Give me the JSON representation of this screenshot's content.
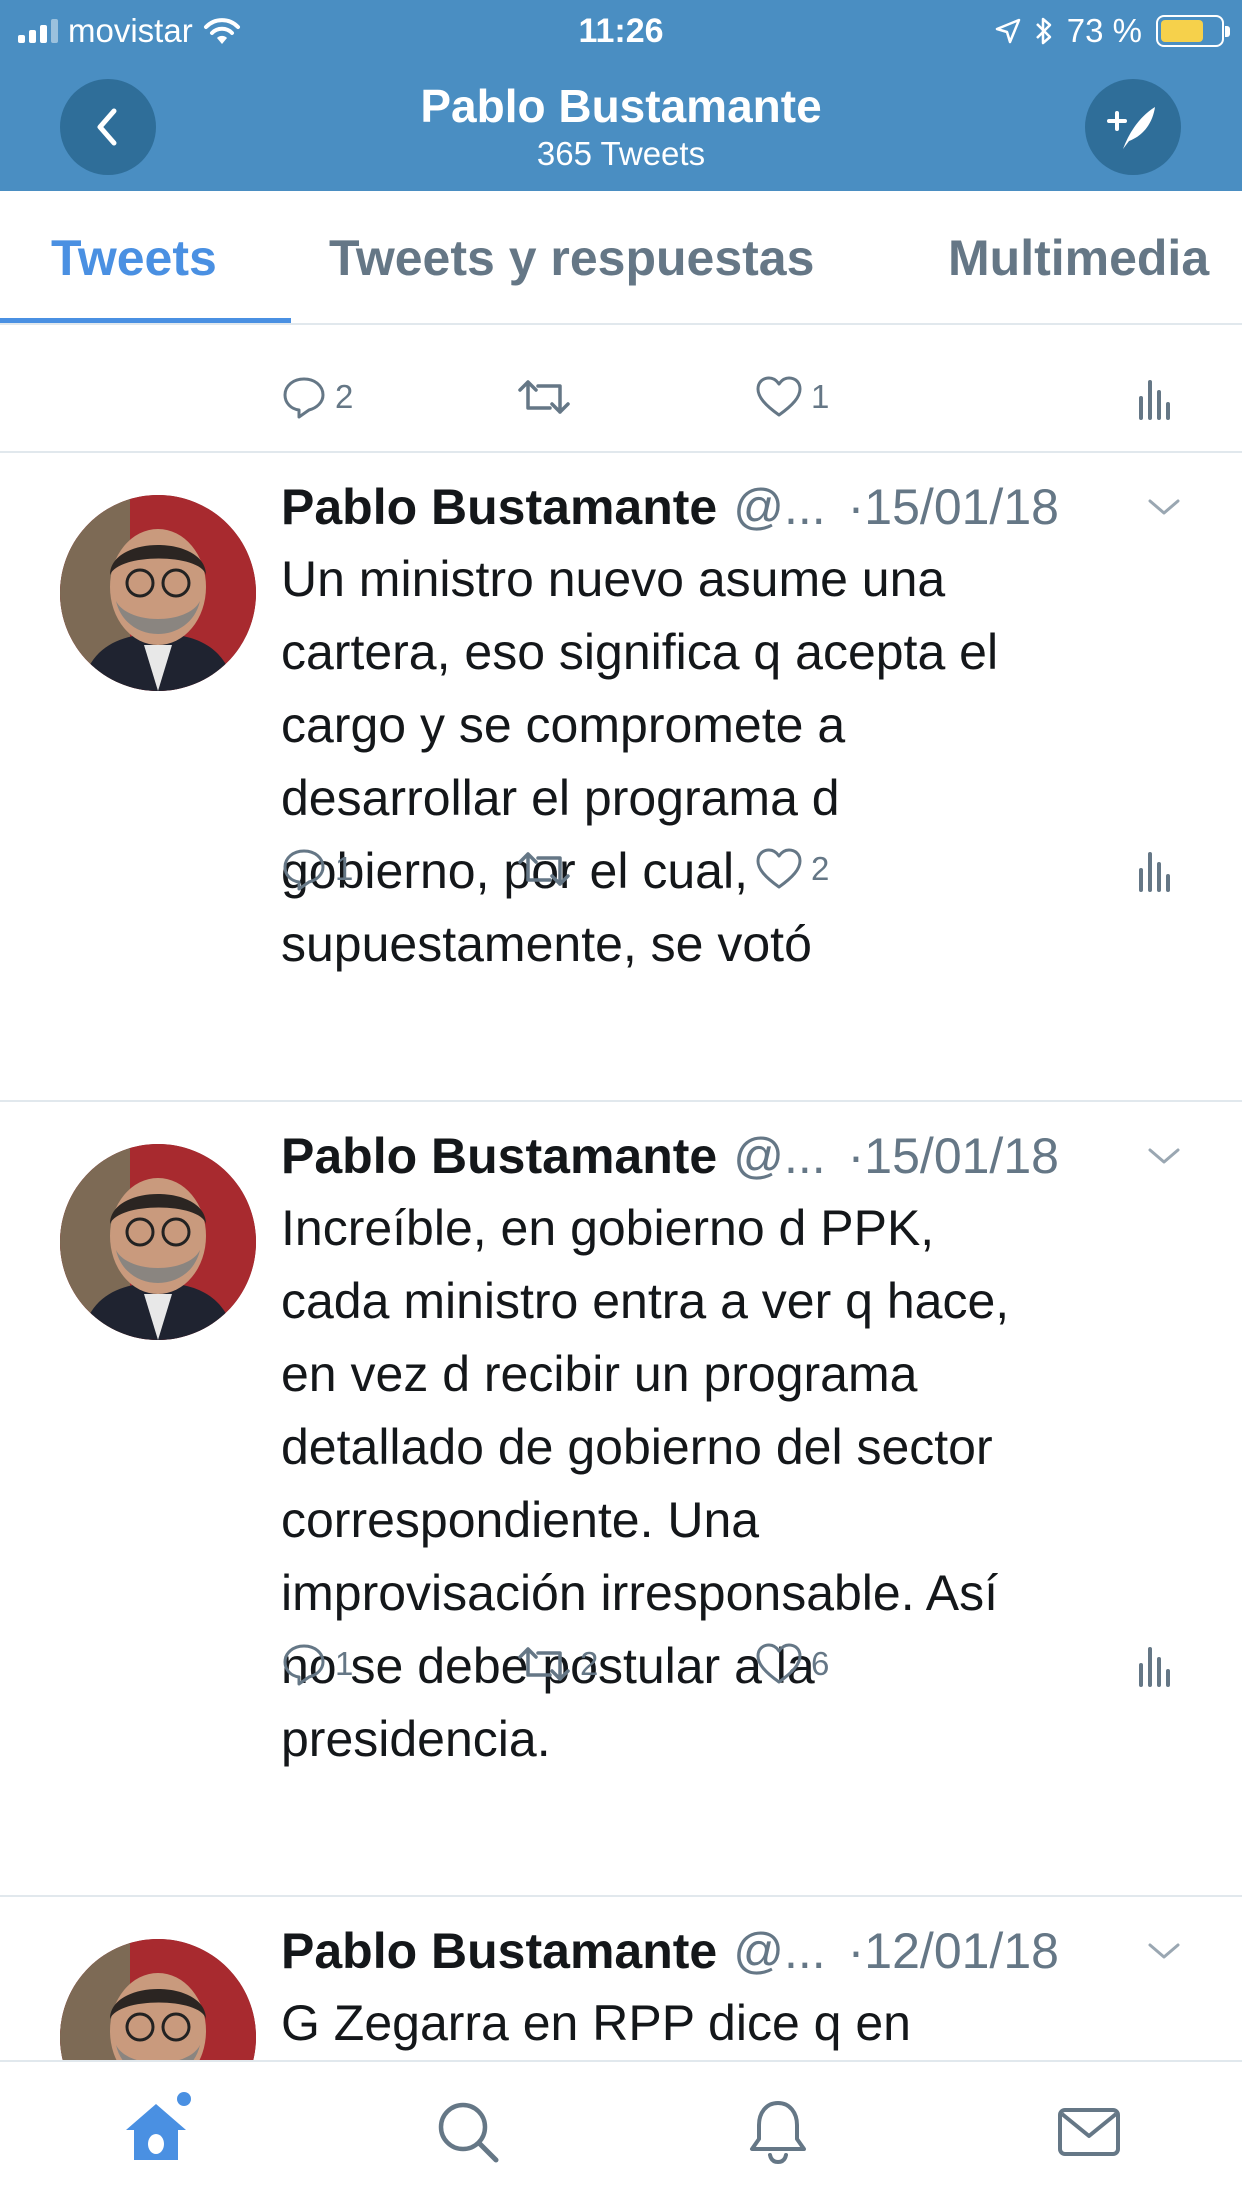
{
  "status_bar": {
    "carrier": "movistar",
    "time": "11:26",
    "battery": "73 %",
    "battery_level": 0.73
  },
  "header": {
    "title": "Pablo Bustamante",
    "subtitle": "365 Tweets",
    "back_icon": "chevron-left-icon",
    "compose_icon": "compose-tweet-icon"
  },
  "tabs": [
    {
      "label": "Tweets",
      "active": true
    },
    {
      "label": "Tweets y respuestas",
      "active": false
    },
    {
      "label": "Multimedia",
      "active": false
    }
  ],
  "first_actions": {
    "replies": "2",
    "retweets": "",
    "likes": "1"
  },
  "tweets": [
    {
      "name": "Pablo Bustamante",
      "handle": "@...",
      "date": "·15/01/18",
      "text": "Un ministro nuevo asume una\ncartera, eso significa q acepta el\ncargo y se compromete a\ndesarrollar el programa d\ngobierno, por el cual,\nsupuestamente, se votó",
      "replies": "1",
      "retweets": "",
      "likes": "2"
    },
    {
      "name": "Pablo Bustamante",
      "handle": "@...",
      "date": "·15/01/18",
      "text": "Increíble, en gobierno d PPK,\ncada ministro entra a ver q hace,\nen vez d recibir un programa\ndetallado de gobierno del sector\ncorrespondiente. Una\nimprovisación irresponsable. Así\nno se debe postular a la\npresidencia.",
      "replies": "1",
      "retweets": "2",
      "likes": "6"
    },
    {
      "name": "Pablo Bustamante",
      "handle": "@...",
      "date": "·12/01/18",
      "text": "G Zegarra en RPP dice q en",
      "replies": "",
      "retweets": "",
      "likes": ""
    }
  ],
  "bottom_nav": [
    {
      "icon": "home-icon",
      "active": true
    },
    {
      "icon": "search-icon",
      "active": false
    },
    {
      "icon": "bell-icon",
      "active": false
    },
    {
      "icon": "mail-icon",
      "active": false
    }
  ],
  "colors": {
    "header_bg": "#4a8ec2",
    "accent": "#4a90e2",
    "secondary_text": "#657786"
  }
}
